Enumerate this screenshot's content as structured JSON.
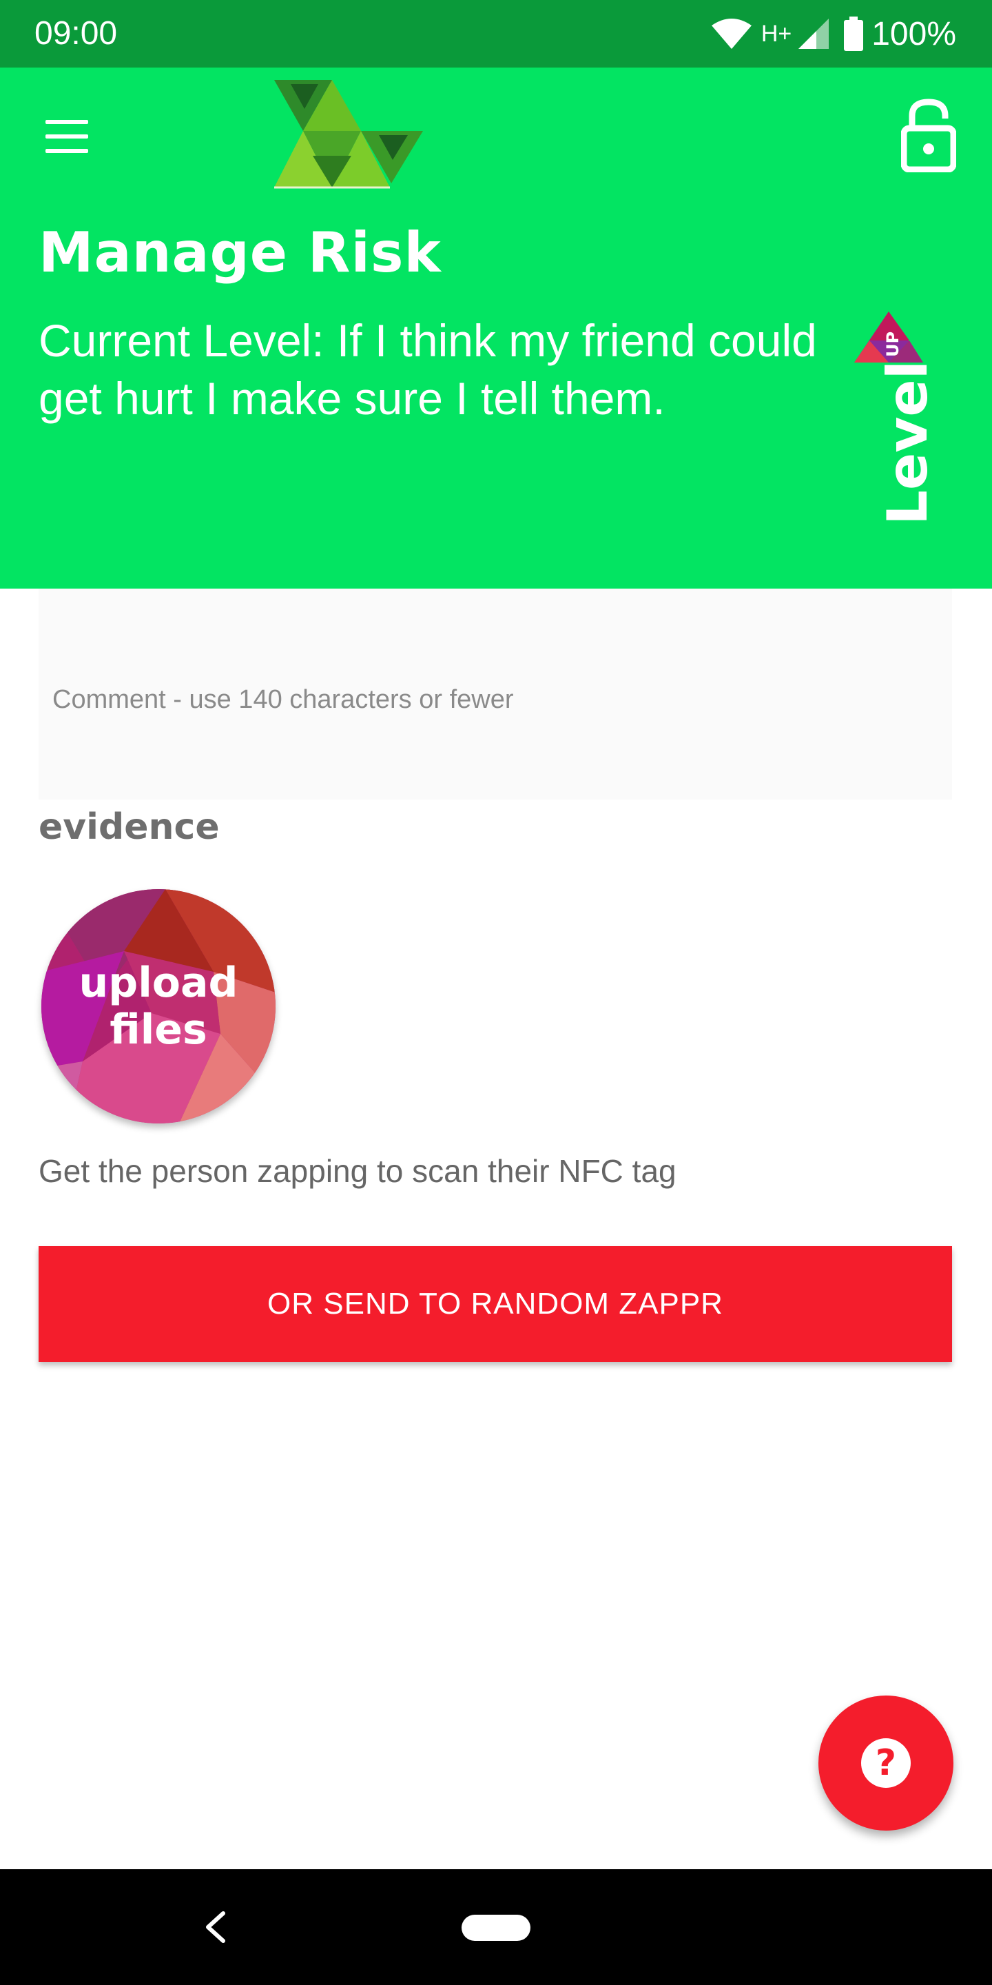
{
  "status_bar": {
    "time": "09:00",
    "network": "H+",
    "battery": "100%",
    "icons": [
      "wifi-icon",
      "signal-icon",
      "battery-icon"
    ]
  },
  "header": {
    "menu_icon": "hamburger-menu-icon",
    "logo_icon": "triangles-logo-icon",
    "lock_icon": "unlock-icon",
    "title": "Manage Risk",
    "current_level": "Current Level: If I think my friend could get hurt I make sure I tell them.",
    "level_up": {
      "badge_text": "UP",
      "text": "Level"
    },
    "background_color": "#03e462"
  },
  "comment": {
    "placeholder": "Comment - use 140 characters or fewer",
    "value": ""
  },
  "evidence": {
    "label": "evidence",
    "upload_line1": "upload",
    "upload_line2": "files"
  },
  "nfc_hint": "Get the person zapping to scan their NFC tag",
  "random_button": {
    "label": "OR SEND TO RANDOM ZAPPR",
    "color": "#f41d2c"
  },
  "help_button": {
    "icon": "question-mark-icon",
    "glyph": "?"
  },
  "nav_bar": {
    "back_icon": "back-chevron-icon",
    "home_icon": "home-pill-icon"
  }
}
